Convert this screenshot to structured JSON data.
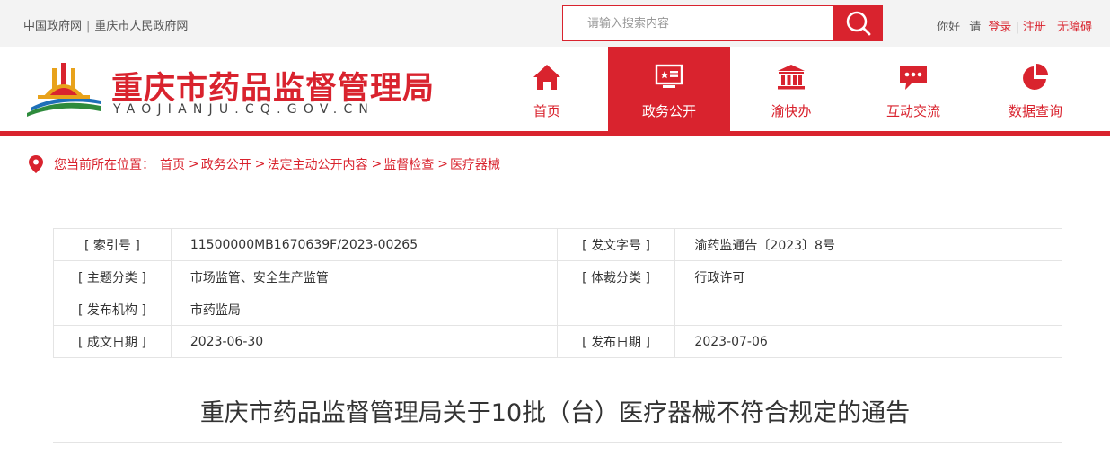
{
  "topbar": {
    "links": [
      "中国政府网",
      "重庆市人民政府网"
    ],
    "search_placeholder": "请输入搜索内容",
    "greeting": "你好",
    "please": "请",
    "login": "登录",
    "register": "注册",
    "accessibility": "无障碍"
  },
  "header": {
    "site_name": "重庆市药品监督管理局",
    "domain": "YAOJIANJU.CQ.GOV.CN",
    "nav": [
      {
        "label": "首页",
        "icon": "home-icon",
        "active": false
      },
      {
        "label": "政务公开",
        "icon": "monitor-star-icon",
        "active": true
      },
      {
        "label": "渝快办",
        "icon": "building-icon",
        "active": false
      },
      {
        "label": "互动交流",
        "icon": "chat-bubble-icon",
        "active": false
      },
      {
        "label": "数据查询",
        "icon": "pie-chart-icon",
        "active": false
      }
    ]
  },
  "breadcrumb": {
    "prefix": "您当前所在位置：",
    "items": [
      "首页",
      "政务公开",
      "法定主动公开内容",
      "监督检查",
      "医疗器械"
    ],
    "arrow": ">"
  },
  "info_table": {
    "rows": [
      {
        "k1": "[ 索引号 ]",
        "v1": "11500000MB1670639F/2023-00265",
        "k2": "[ 发文字号 ]",
        "v2": "渝药监通告〔2023〕8号"
      },
      {
        "k1": "[ 主题分类 ]",
        "v1": "市场监管、安全生产监管",
        "k2": "[ 体裁分类 ]",
        "v2": "行政许可"
      },
      {
        "k1": "[ 发布机构 ]",
        "v1": "市药监局",
        "k2": "",
        "v2": ""
      },
      {
        "k1": "[ 成文日期 ]",
        "v1": "2023-06-30",
        "k2": "[ 发布日期 ]",
        "v2": "2023-07-06"
      }
    ]
  },
  "article": {
    "title": "重庆市药品监督管理局关于10批（台）医疗器械不符合规定的通告"
  },
  "colors": {
    "brand_red": "#d9232e",
    "topbar_bg": "#f3f3f3",
    "border": "#e4e4e4"
  }
}
